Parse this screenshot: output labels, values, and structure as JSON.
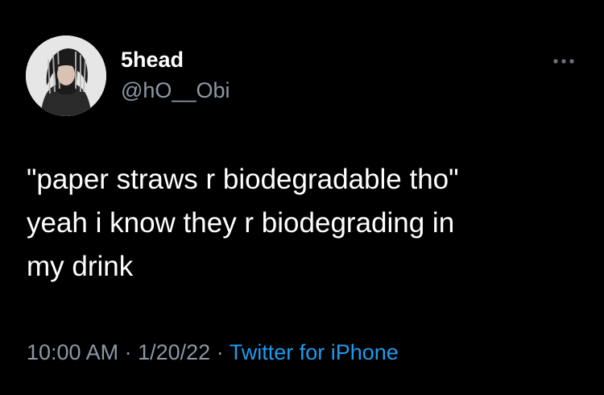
{
  "user": {
    "display_name": "5head",
    "handle": "@hO__Obi"
  },
  "tweet": {
    "lines": [
      "\"paper straws r biodegradable tho\"",
      "yeah i know they r biodegrading in",
      "my drink"
    ],
    "time": "10:00 AM",
    "separator": "·",
    "date": "1/20/22",
    "source": "Twitter for iPhone"
  },
  "icons": {
    "more": "more-options-icon",
    "avatar": "avatar"
  },
  "colors": {
    "background": "#000000",
    "text": "#ffffff",
    "secondary_text": "#8b98a5",
    "link": "#1d9bf0"
  }
}
